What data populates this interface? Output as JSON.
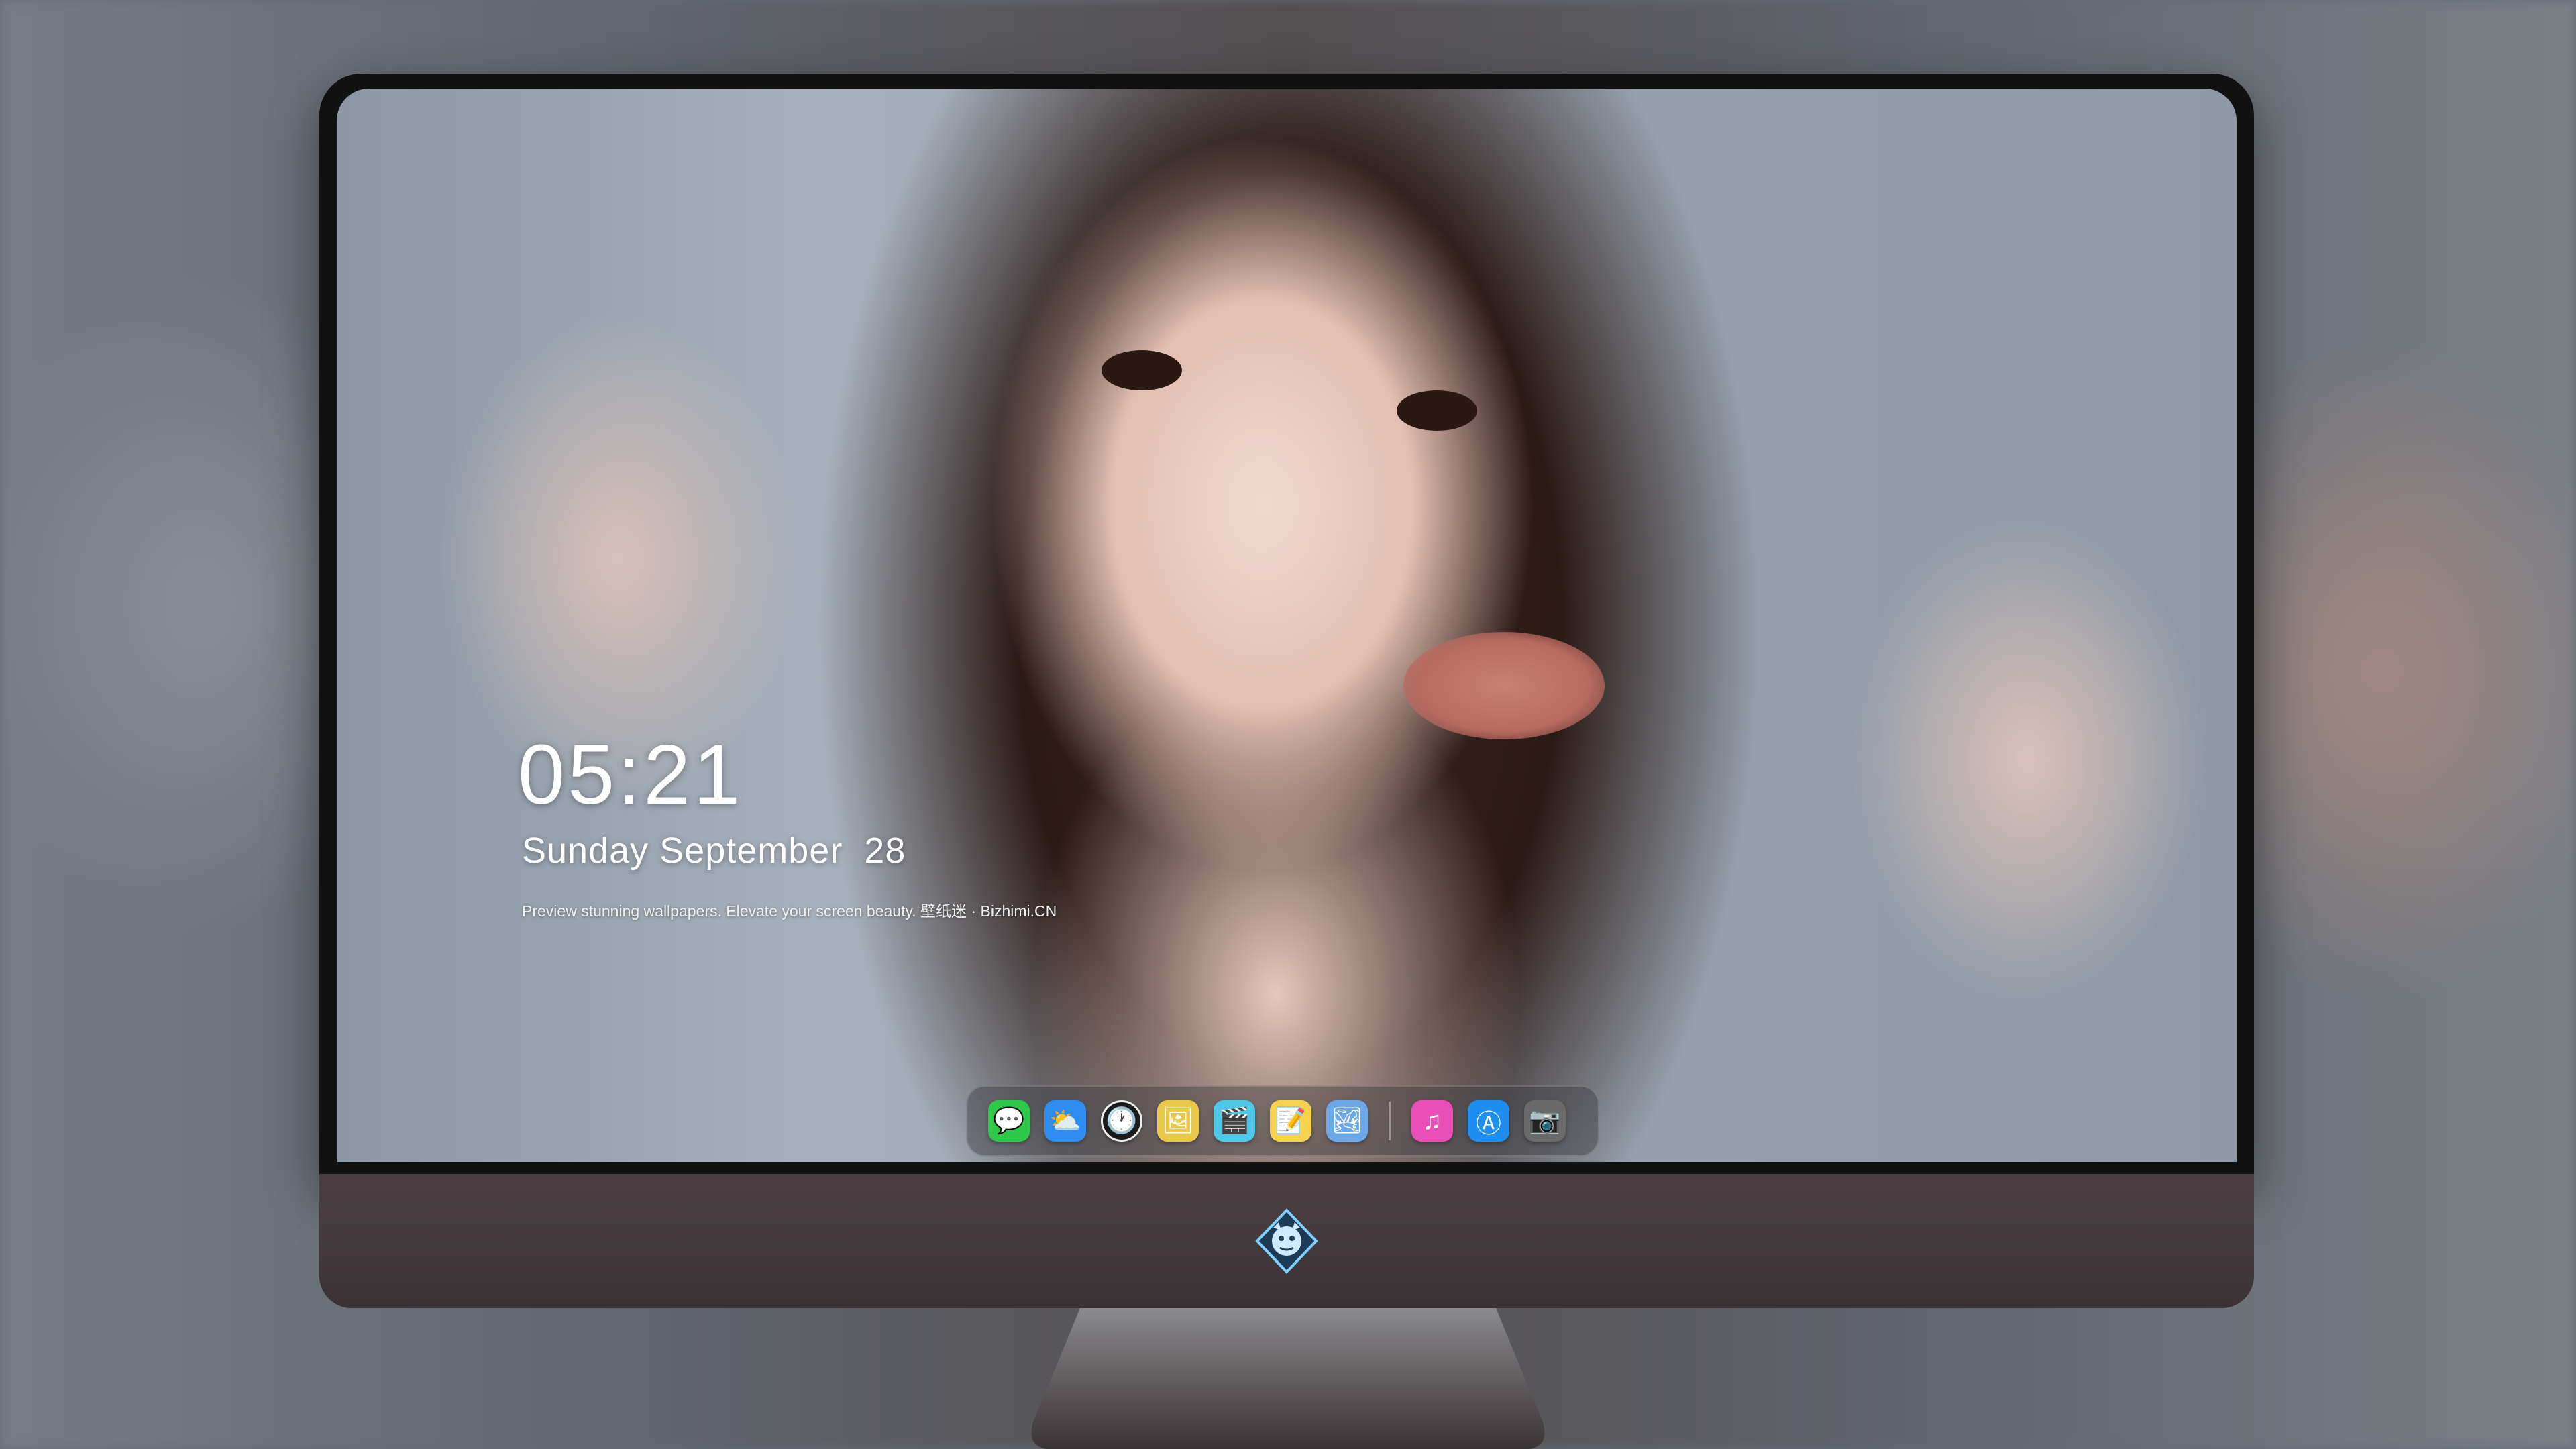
{
  "lockscreen": {
    "time": "05:21",
    "date": "Sunday September  28",
    "tagline": "Preview stunning wallpapers. Elevate your screen beauty. 壁纸迷 · Bizhimi.CN"
  },
  "dock": {
    "apps": [
      {
        "name": "messages-icon",
        "glyph": "💬",
        "color": "#2fc94a"
      },
      {
        "name": "weather-icon",
        "glyph": "⛅",
        "color": "#2f8cf0"
      },
      {
        "name": "clock-icon",
        "glyph": "🕐",
        "color": "#1b1b1b"
      },
      {
        "name": "preview-icon",
        "glyph": "🖼",
        "color": "#e9c94a"
      },
      {
        "name": "clips-icon",
        "glyph": "🎬",
        "color": "#4fc7e6"
      },
      {
        "name": "notes-icon",
        "glyph": "📝",
        "color": "#f6d24e"
      },
      {
        "name": "photos-icon",
        "glyph": "🏞",
        "color": "#6aa8e8"
      },
      {
        "name": "music-icon",
        "glyph": "♫",
        "color": "#e94fb6"
      },
      {
        "name": "app-store-icon",
        "glyph": "Ⓐ",
        "color": "#1e8ff0"
      },
      {
        "name": "camera-icon",
        "glyph": "📷",
        "color": "#6a6a6a"
      }
    ]
  }
}
